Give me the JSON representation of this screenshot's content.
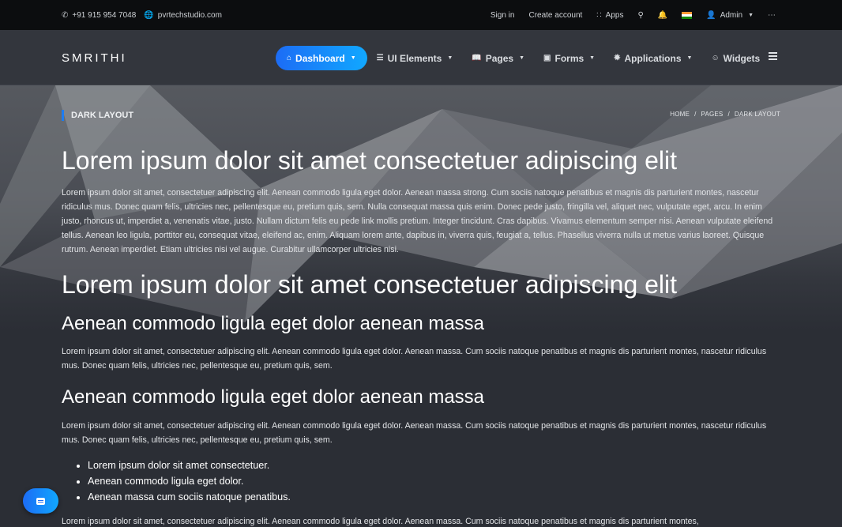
{
  "topbar": {
    "phone": "+91 915 954 7048",
    "website": "pvrtechstudio.com",
    "sign_in": "Sign in",
    "create_account": "Create account",
    "apps": "Apps",
    "admin": "Admin"
  },
  "brand": {
    "logo": "SMRITHI"
  },
  "nav": {
    "items": [
      {
        "label": "Dashboard",
        "icon": "home-icon"
      },
      {
        "label": "UI Elements",
        "icon": "sliders-icon"
      },
      {
        "label": "Pages",
        "icon": "book-icon"
      },
      {
        "label": "Forms",
        "icon": "briefcase-icon"
      },
      {
        "label": "Applications",
        "icon": "settings-icon"
      },
      {
        "label": "Widgets",
        "icon": "smile-icon"
      }
    ]
  },
  "page": {
    "title": "DARK LAYOUT",
    "breadcrumb": [
      "HOME",
      "/",
      "PAGES",
      "/",
      "DARK LAYOUT"
    ]
  },
  "content": {
    "h1_a": "Lorem ipsum dolor sit amet consectetuer adipiscing elit",
    "p1": "Lorem ipsum dolor sit amet, consectetuer adipiscing elit. Aenean commodo ligula eget dolor. Aenean massa strong. Cum sociis natoque penatibus et magnis dis parturient montes, nascetur ridiculus mus. Donec quam felis, ultricies nec, pellentesque eu, pretium quis, sem. Nulla consequat massa quis enim. Donec pede justo, fringilla vel, aliquet nec, vulputate eget, arcu. In enim justo, rhoncus ut, imperdiet a, venenatis vitae, justo. Nullam dictum felis eu pede link mollis pretium. Integer tincidunt. Cras dapibus. Vivamus elementum semper nisi. Aenean vulputate eleifend tellus. Aenean leo ligula, porttitor eu, consequat vitae, eleifend ac, enim. Aliquam lorem ante, dapibus in, viverra quis, feugiat a, tellus. Phasellus viverra nulla ut metus varius laoreet. Quisque rutrum. Aenean imperdiet. Etiam ultricies nisi vel augue. Curabitur ullamcorper ultricies nisi.",
    "h1_b": "Lorem ipsum dolor sit amet consectetuer adipiscing elit",
    "h2_a": "Aenean commodo ligula eget dolor aenean massa",
    "p2": "Lorem ipsum dolor sit amet, consectetuer adipiscing elit. Aenean commodo ligula eget dolor. Aenean massa. Cum sociis natoque penatibus et magnis dis parturient montes, nascetur ridiculus mus. Donec quam felis, ultricies nec, pellentesque eu, pretium quis, sem.",
    "h2_b": "Aenean commodo ligula eget dolor aenean massa",
    "p3": "Lorem ipsum dolor sit amet, consectetuer adipiscing elit. Aenean commodo ligula eget dolor. Aenean massa. Cum sociis natoque penatibus et magnis dis parturient montes, nascetur ridiculus mus. Donec quam felis, ultricies nec, pellentesque eu, pretium quis, sem.",
    "list": [
      "Lorem ipsum dolor sit amet consectetuer.",
      "Aenean commodo ligula eget dolor.",
      "Aenean massa cum sociis natoque penatibus."
    ],
    "p4": "Lorem ipsum dolor sit amet, consectetuer adipiscing elit. Aenean commodo ligula eget dolor. Aenean massa. Cum sociis natoque penatibus et magnis dis parturient montes,"
  },
  "colors": {
    "accent": "#1c6cf5",
    "accent_light": "#11a8ff",
    "topbar_bg": "#0c0d0f",
    "header_bg": "#33363d",
    "body_bg": "#2b2e35"
  }
}
